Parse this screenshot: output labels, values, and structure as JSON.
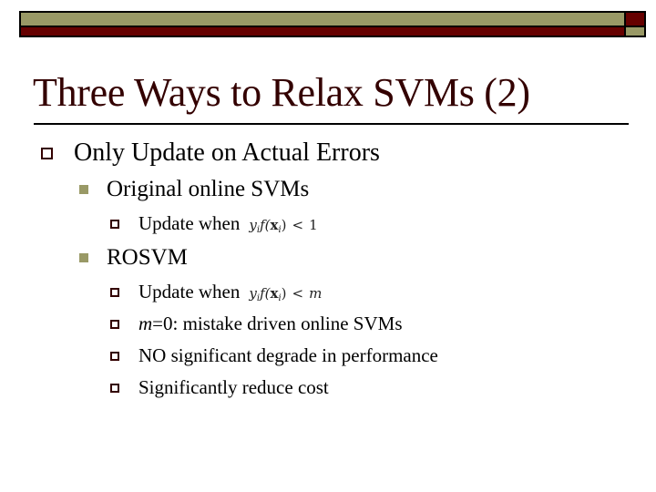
{
  "slide": {
    "title": "Three Ways to Relax SVMs (2)",
    "colors": {
      "banner_olive": "#999966",
      "banner_maroon": "#660000",
      "title": "#330000",
      "bullet_hollow": "#330000",
      "bullet_filled": "#999966"
    },
    "bullets": [
      {
        "level": 1,
        "icon": "hollow-square-bullet",
        "text": "Only Update on Actual Errors"
      },
      {
        "level": 2,
        "icon": "filled-square-bullet",
        "text": "Original online SVMs"
      },
      {
        "level": 3,
        "icon": "hollow-square-bullet",
        "text": "Update when",
        "math": {
          "y": "y",
          "y_sub": "i",
          "f": "f(",
          "x": "x",
          "x_sub": "i",
          "close": ")",
          "relation": "<",
          "rhs": "1"
        }
      },
      {
        "level": 2,
        "icon": "filled-square-bullet",
        "text": "ROSVM"
      },
      {
        "level": 3,
        "icon": "hollow-square-bullet",
        "text": "Update when",
        "math": {
          "y": "y",
          "y_sub": "i",
          "f": "f(",
          "x": "x",
          "x_sub": "i",
          "close": ")",
          "relation": "<",
          "rhs": "m"
        }
      },
      {
        "level": 3,
        "icon": "hollow-square-bullet",
        "emph": "m",
        "text": "=0: mistake driven online SVMs"
      },
      {
        "level": 3,
        "icon": "hollow-square-bullet",
        "text": "NO significant degrade in performance"
      },
      {
        "level": 3,
        "icon": "hollow-square-bullet",
        "text": "Significantly reduce cost"
      }
    ]
  }
}
